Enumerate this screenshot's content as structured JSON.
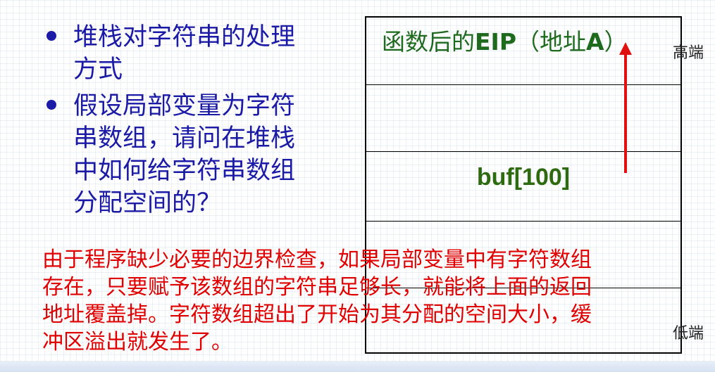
{
  "bullets": [
    {
      "lines": [
        "堆栈对字符串的处理",
        "方式"
      ]
    },
    {
      "lines": [
        "假设局部变量为字符",
        "串数组，请问在堆栈",
        "中如何给字符串数组",
        "分配空间的？"
      ]
    }
  ],
  "stack": {
    "eip_prefix": "函数后的",
    "eip_bold": "EIP",
    "eip_mid": "（地址",
    "eip_addr": "A",
    "eip_end": "）",
    "buf_label": "buf[100]",
    "high_label": "高端",
    "low_label": "低端"
  },
  "explanation": [
    "由于程序缺少必要的边界检查，如果局部变量中有字符数组",
    "存在，只要赋予该数组的字符串足够长，就能将上面的返回",
    "地址覆盖掉。字符数组超出了开始为其分配的空间大小，缓",
    "冲区溢出就发生了。"
  ],
  "colors": {
    "bullet_text": "#1a1aa6",
    "eip_text": "#1e6b1e",
    "buf_text": "#2d6a10",
    "explanation_text": "#e00000",
    "arrow": "#e01010"
  }
}
